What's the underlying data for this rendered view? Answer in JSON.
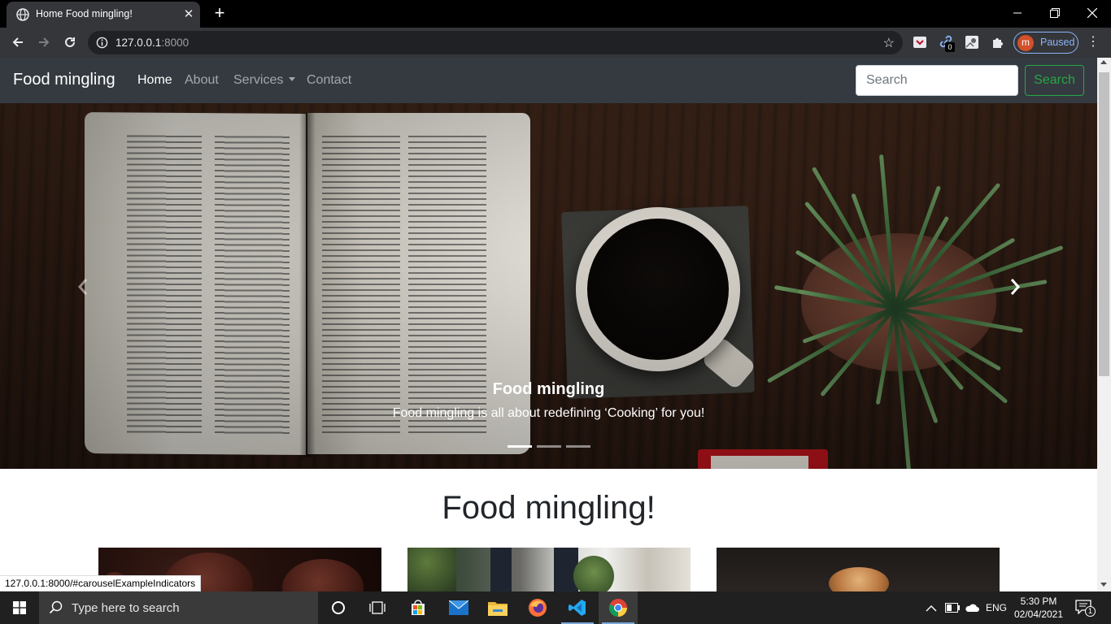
{
  "browser": {
    "tab_title": "Home Food mingling!",
    "url_host": "127.0.0.1",
    "url_port": ":8000",
    "profile_initial": "m",
    "profile_status": "Paused",
    "extension_badge": "0",
    "status_url": "127.0.0.1:8000/#carouselExampleIndicators"
  },
  "navbar": {
    "brand": "Food mingling",
    "links": [
      {
        "label": "Home",
        "active": true
      },
      {
        "label": "About",
        "active": false
      },
      {
        "label": "Services",
        "active": false,
        "dropdown": true
      },
      {
        "label": "Contact",
        "active": false
      }
    ],
    "search_placeholder": "Search",
    "search_button": "Search",
    "accent_color": "#28a745"
  },
  "carousel": {
    "caption_title": "Food mingling",
    "caption_text": "Food mingling is all about redefining ‘Cooking’ for you!",
    "slide_count": 3,
    "active_slide": 0
  },
  "main": {
    "heading": "Food mingling!",
    "cards": [
      {
        "image": "muffins"
      },
      {
        "image": "kitchen-window-plants"
      },
      {
        "image": "bread"
      }
    ]
  },
  "taskbar": {
    "search_placeholder": "Type here to search",
    "language": "ENG",
    "time": "5:30 PM",
    "date": "02/04/2021",
    "notification_count": "1",
    "pinned_apps": [
      "task-view",
      "microsoft-store",
      "mail",
      "file-explorer",
      "firefox",
      "vscode",
      "chrome"
    ]
  }
}
